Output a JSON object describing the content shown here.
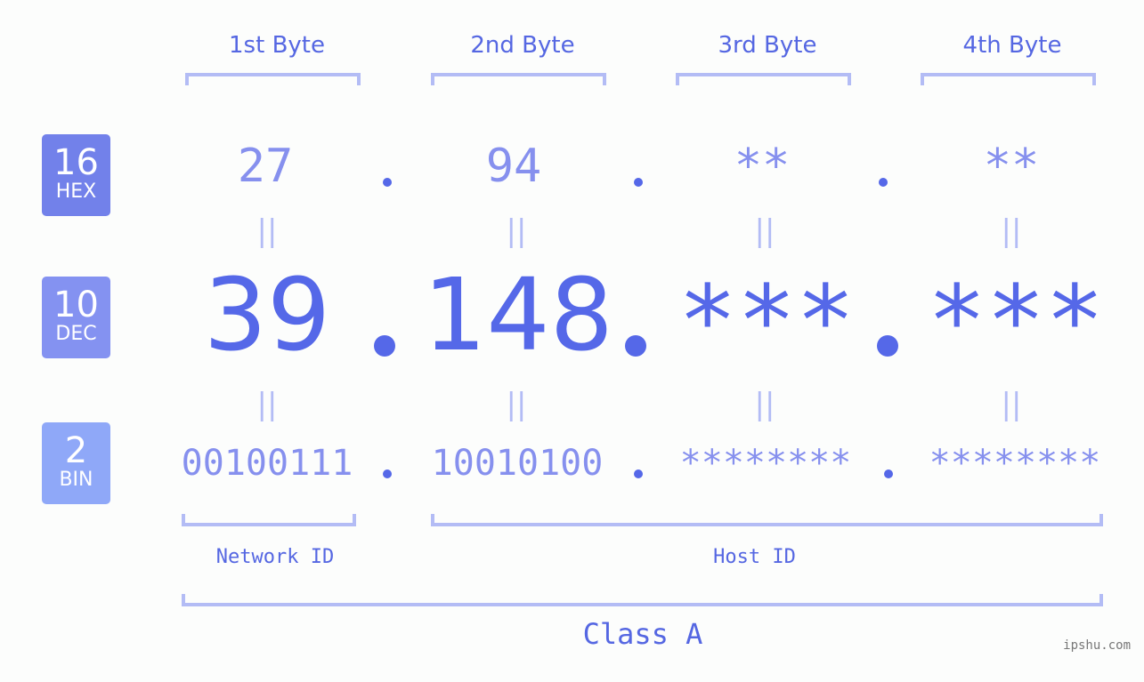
{
  "bases": [
    {
      "number": "16",
      "label": "HEX",
      "color": "#7281ea"
    },
    {
      "number": "10",
      "label": "DEC",
      "color": "#8492f1"
    },
    {
      "number": "2",
      "label": "BIN",
      "color": "#8fa8f8"
    }
  ],
  "byte_titles": [
    "1st Byte",
    "2nd Byte",
    "3rd Byte",
    "4th Byte"
  ],
  "hex": [
    "27",
    "94",
    "**",
    "**"
  ],
  "dec": [
    "39",
    "148",
    "***",
    "***"
  ],
  "bin": [
    "00100111",
    "10010100",
    "********",
    "********"
  ],
  "equals_symbol": "||",
  "parts": {
    "network": "Network ID",
    "host": "Host ID"
  },
  "class_label": "Class A",
  "footer": "ipshu.com",
  "colors": {
    "accent": "#5568e8",
    "light_accent": "#8690ee",
    "bracket": "#b3bcf5",
    "background": "#fcfdfc"
  }
}
